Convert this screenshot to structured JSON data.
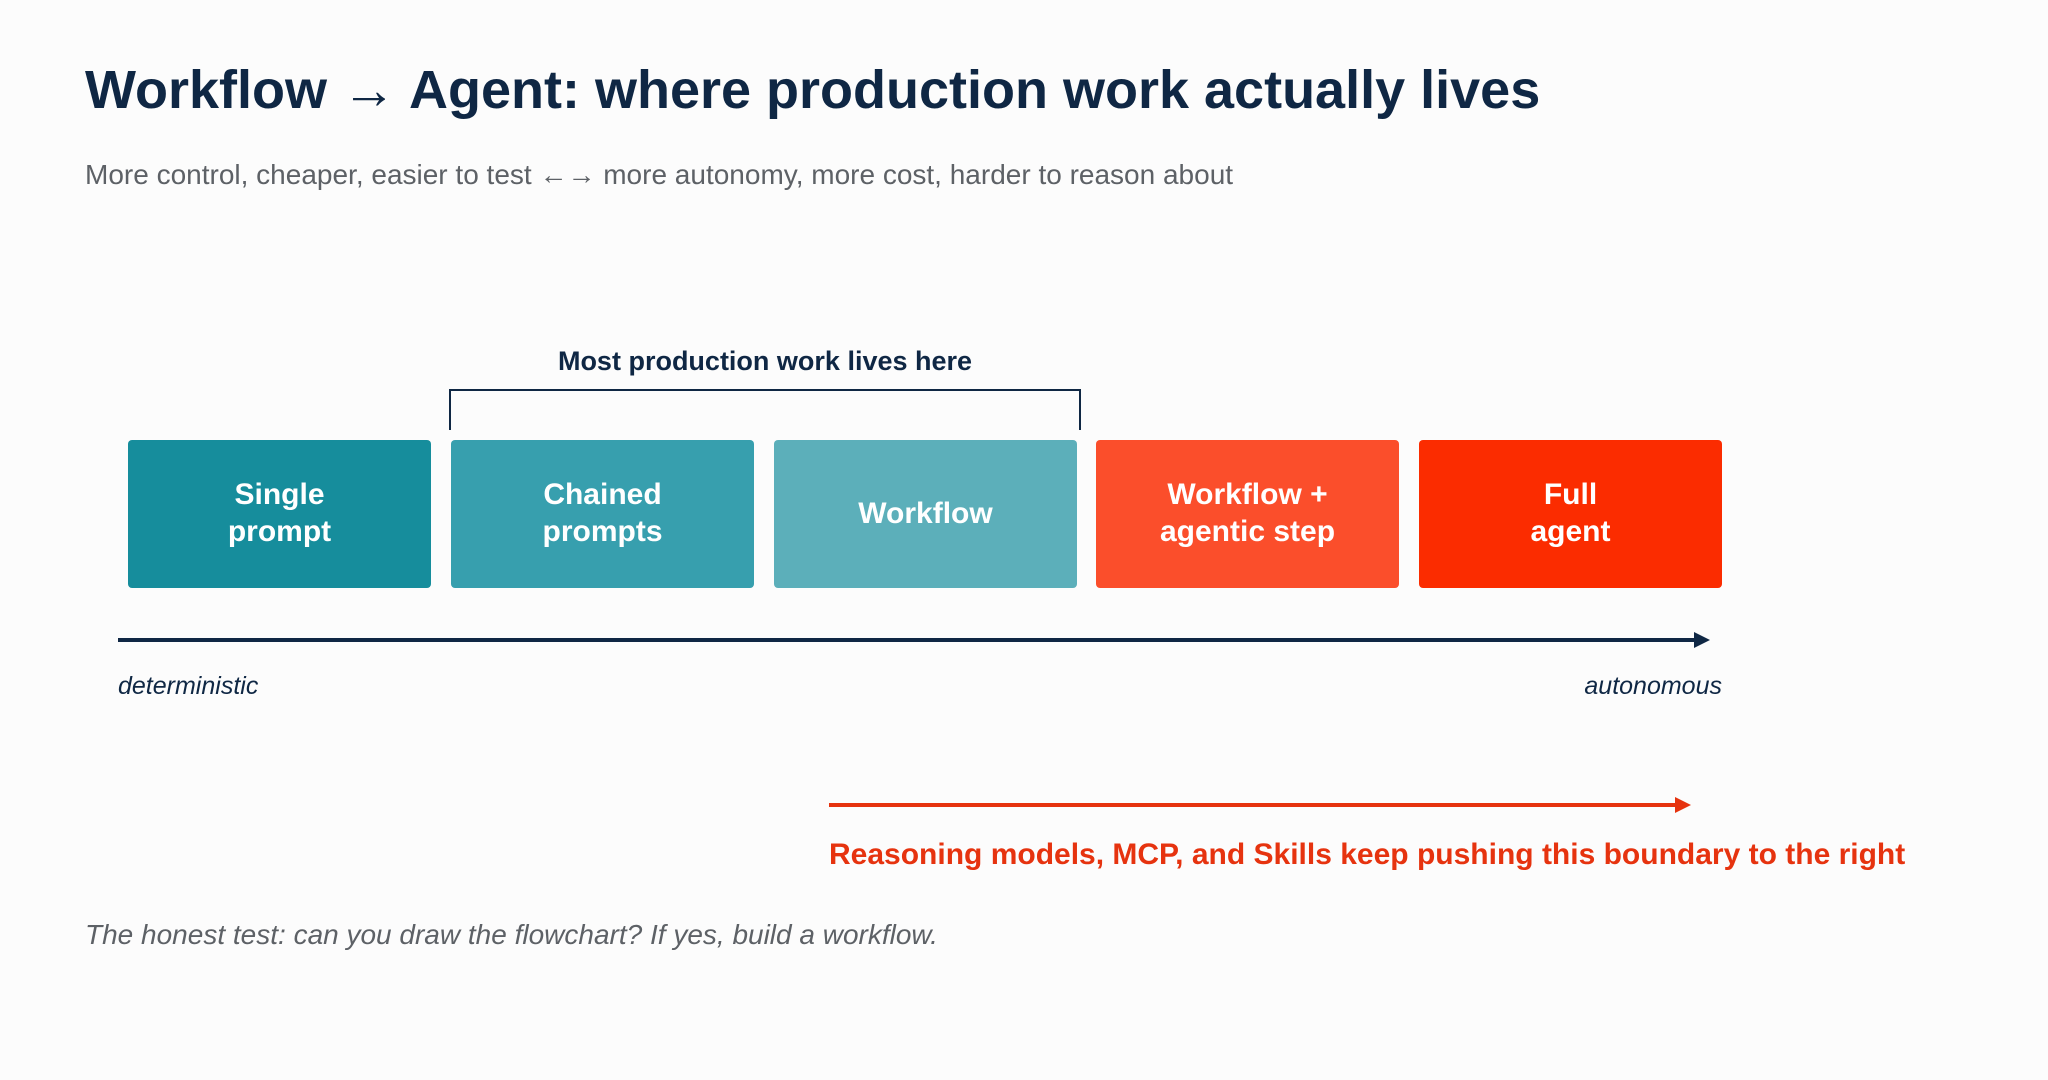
{
  "title": "Workflow → Agent: where production work actually lives",
  "subtitle": "More control, cheaper, easier to test ←→ more autonomy, more cost, harder to reason about",
  "bracket_label": "Most production work lives here",
  "stages": [
    {
      "label": "Single\nprompt",
      "color": "#168d9c"
    },
    {
      "label": "Chained\nprompts",
      "color": "#379fae"
    },
    {
      "label": "Workflow",
      "color": "#5cafba"
    },
    {
      "label": "Workflow +\nagentic step",
      "color": "#fb4e2b"
    },
    {
      "label": "Full\nagent",
      "color": "#fb2c00"
    }
  ],
  "axis": {
    "left_label": "deterministic",
    "right_label": "autonomous"
  },
  "push_note": "Reasoning models, MCP, and Skills keep pushing this boundary to the right",
  "footer": "The honest test: can you draw the flowchart? If yes, build a workflow.",
  "colors": {
    "title": "#0f2744",
    "accent_red": "#e6330f",
    "muted_text": "#5d6166",
    "background": "#fcfcfc"
  }
}
